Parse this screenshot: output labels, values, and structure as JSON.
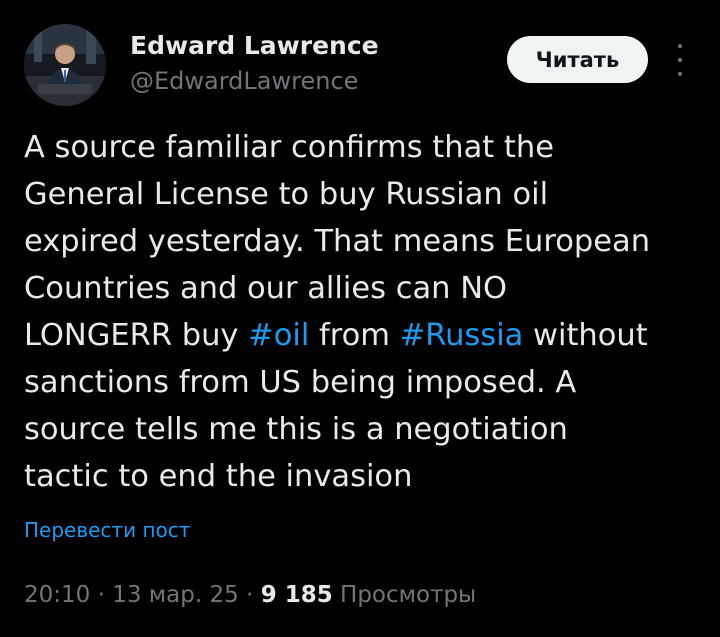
{
  "author": {
    "name": "Edward Lawrence",
    "handle": "@EdwardLawrence"
  },
  "follow_button_label": "Читать",
  "more_icon": "more-vertical-icon",
  "tweet": {
    "lines": [
      {
        "before": "A source familiar confirms that the",
        "tag": "",
        "after": "",
        "tag2": "",
        "after2": ""
      },
      {
        "before": "General License to buy Russian oil",
        "tag": "",
        "after": "",
        "tag2": "",
        "after2": ""
      },
      {
        "before": "expired yesterday. That means European",
        "tag": "",
        "after": "",
        "tag2": "",
        "after2": ""
      },
      {
        "before": "Countries and our allies can NO",
        "tag": "",
        "after": "",
        "tag2": "",
        "after2": ""
      },
      {
        "before": "LONGERR buy ",
        "tag": "#oil",
        "after": " from ",
        "tag2": "#Russia",
        "after2": " without"
      },
      {
        "before": "sanctions from US being imposed. A",
        "tag": "",
        "after": "",
        "tag2": "",
        "after2": ""
      },
      {
        "before": "source tells me this is a negotiation",
        "tag": "",
        "after": "",
        "tag2": "",
        "after2": ""
      },
      {
        "before": "tactic to end the invasion",
        "tag": "",
        "after": "",
        "tag2": "",
        "after2": ""
      }
    ]
  },
  "translate_label": "Перевести пост",
  "meta": {
    "time": "20:10",
    "separator": " · ",
    "date": "13 мар. 25",
    "views_count": "9 185",
    "views_label": " Просмотры"
  },
  "colors": {
    "background": "#000000",
    "text": "#e7e9ea",
    "secondary": "#71767b",
    "link": "#1d9bf0",
    "button_bg": "#eff3f4"
  }
}
